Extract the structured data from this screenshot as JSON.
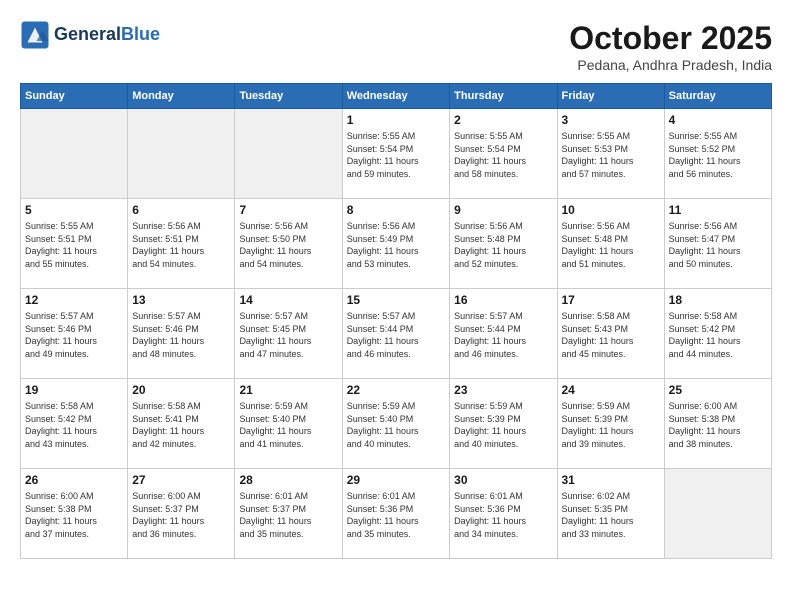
{
  "header": {
    "logo_line1": "General",
    "logo_line2": "Blue",
    "month": "October 2025",
    "location": "Pedana, Andhra Pradesh, India"
  },
  "days_of_week": [
    "Sunday",
    "Monday",
    "Tuesday",
    "Wednesday",
    "Thursday",
    "Friday",
    "Saturday"
  ],
  "weeks": [
    [
      {
        "day": "",
        "info": ""
      },
      {
        "day": "",
        "info": ""
      },
      {
        "day": "",
        "info": ""
      },
      {
        "day": "1",
        "info": "Sunrise: 5:55 AM\nSunset: 5:54 PM\nDaylight: 11 hours\nand 59 minutes."
      },
      {
        "day": "2",
        "info": "Sunrise: 5:55 AM\nSunset: 5:54 PM\nDaylight: 11 hours\nand 58 minutes."
      },
      {
        "day": "3",
        "info": "Sunrise: 5:55 AM\nSunset: 5:53 PM\nDaylight: 11 hours\nand 57 minutes."
      },
      {
        "day": "4",
        "info": "Sunrise: 5:55 AM\nSunset: 5:52 PM\nDaylight: 11 hours\nand 56 minutes."
      }
    ],
    [
      {
        "day": "5",
        "info": "Sunrise: 5:55 AM\nSunset: 5:51 PM\nDaylight: 11 hours\nand 55 minutes."
      },
      {
        "day": "6",
        "info": "Sunrise: 5:56 AM\nSunset: 5:51 PM\nDaylight: 11 hours\nand 54 minutes."
      },
      {
        "day": "7",
        "info": "Sunrise: 5:56 AM\nSunset: 5:50 PM\nDaylight: 11 hours\nand 54 minutes."
      },
      {
        "day": "8",
        "info": "Sunrise: 5:56 AM\nSunset: 5:49 PM\nDaylight: 11 hours\nand 53 minutes."
      },
      {
        "day": "9",
        "info": "Sunrise: 5:56 AM\nSunset: 5:48 PM\nDaylight: 11 hours\nand 52 minutes."
      },
      {
        "day": "10",
        "info": "Sunrise: 5:56 AM\nSunset: 5:48 PM\nDaylight: 11 hours\nand 51 minutes."
      },
      {
        "day": "11",
        "info": "Sunrise: 5:56 AM\nSunset: 5:47 PM\nDaylight: 11 hours\nand 50 minutes."
      }
    ],
    [
      {
        "day": "12",
        "info": "Sunrise: 5:57 AM\nSunset: 5:46 PM\nDaylight: 11 hours\nand 49 minutes."
      },
      {
        "day": "13",
        "info": "Sunrise: 5:57 AM\nSunset: 5:46 PM\nDaylight: 11 hours\nand 48 minutes."
      },
      {
        "day": "14",
        "info": "Sunrise: 5:57 AM\nSunset: 5:45 PM\nDaylight: 11 hours\nand 47 minutes."
      },
      {
        "day": "15",
        "info": "Sunrise: 5:57 AM\nSunset: 5:44 PM\nDaylight: 11 hours\nand 46 minutes."
      },
      {
        "day": "16",
        "info": "Sunrise: 5:57 AM\nSunset: 5:44 PM\nDaylight: 11 hours\nand 46 minutes."
      },
      {
        "day": "17",
        "info": "Sunrise: 5:58 AM\nSunset: 5:43 PM\nDaylight: 11 hours\nand 45 minutes."
      },
      {
        "day": "18",
        "info": "Sunrise: 5:58 AM\nSunset: 5:42 PM\nDaylight: 11 hours\nand 44 minutes."
      }
    ],
    [
      {
        "day": "19",
        "info": "Sunrise: 5:58 AM\nSunset: 5:42 PM\nDaylight: 11 hours\nand 43 minutes."
      },
      {
        "day": "20",
        "info": "Sunrise: 5:58 AM\nSunset: 5:41 PM\nDaylight: 11 hours\nand 42 minutes."
      },
      {
        "day": "21",
        "info": "Sunrise: 5:59 AM\nSunset: 5:40 PM\nDaylight: 11 hours\nand 41 minutes."
      },
      {
        "day": "22",
        "info": "Sunrise: 5:59 AM\nSunset: 5:40 PM\nDaylight: 11 hours\nand 40 minutes."
      },
      {
        "day": "23",
        "info": "Sunrise: 5:59 AM\nSunset: 5:39 PM\nDaylight: 11 hours\nand 40 minutes."
      },
      {
        "day": "24",
        "info": "Sunrise: 5:59 AM\nSunset: 5:39 PM\nDaylight: 11 hours\nand 39 minutes."
      },
      {
        "day": "25",
        "info": "Sunrise: 6:00 AM\nSunset: 5:38 PM\nDaylight: 11 hours\nand 38 minutes."
      }
    ],
    [
      {
        "day": "26",
        "info": "Sunrise: 6:00 AM\nSunset: 5:38 PM\nDaylight: 11 hours\nand 37 minutes."
      },
      {
        "day": "27",
        "info": "Sunrise: 6:00 AM\nSunset: 5:37 PM\nDaylight: 11 hours\nand 36 minutes."
      },
      {
        "day": "28",
        "info": "Sunrise: 6:01 AM\nSunset: 5:37 PM\nDaylight: 11 hours\nand 35 minutes."
      },
      {
        "day": "29",
        "info": "Sunrise: 6:01 AM\nSunset: 5:36 PM\nDaylight: 11 hours\nand 35 minutes."
      },
      {
        "day": "30",
        "info": "Sunrise: 6:01 AM\nSunset: 5:36 PM\nDaylight: 11 hours\nand 34 minutes."
      },
      {
        "day": "31",
        "info": "Sunrise: 6:02 AM\nSunset: 5:35 PM\nDaylight: 11 hours\nand 33 minutes."
      },
      {
        "day": "",
        "info": ""
      }
    ]
  ]
}
